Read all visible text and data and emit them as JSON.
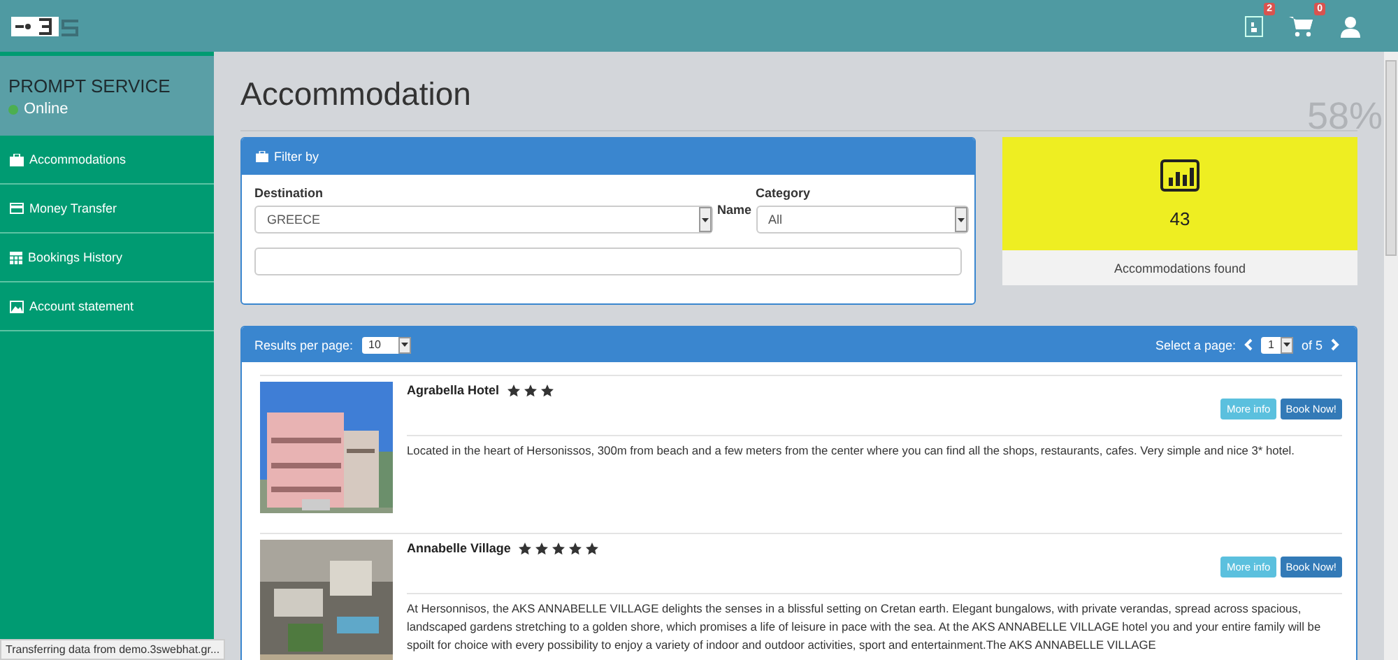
{
  "topbar": {
    "notifications": [
      {
        "kind": "bookings",
        "badge": "2"
      },
      {
        "kind": "cart",
        "badge": "0"
      },
      {
        "kind": "user"
      }
    ]
  },
  "sidebar": {
    "title": "PROMPT SERVICE",
    "status": "Online",
    "items": [
      {
        "label": "Accommodations"
      },
      {
        "label": "Money Transfer"
      },
      {
        "label": "Bookings History"
      },
      {
        "label": "Account statement"
      }
    ]
  },
  "page": {
    "title": "Accommodation",
    "progress": "58%"
  },
  "filter": {
    "title": "Filter by",
    "destination_label": "Destination",
    "destination": "GREECE",
    "name_label": "Name",
    "category_label": "Category",
    "category": "All"
  },
  "stats": {
    "count": "43",
    "label": "Accommodations found"
  },
  "results": {
    "per_page_label": "Results per page:",
    "per_page": "10",
    "page_label": "Select a page:",
    "page": "1",
    "of": "of 5",
    "hotels": [
      {
        "name": "Agrabella Hotel",
        "stars": 3,
        "more": "More info",
        "book": "Book Now!",
        "description": "Located in the heart of Hersonissos, 300m from beach and a few meters from the center where you can find all the shops, restaurants, cafes. Very simple and nice 3* hotel.",
        "kind": "picture"
      },
      {
        "name": "Annabelle Village",
        "stars": 5,
        "more": "More info",
        "book": "Book Now!",
        "description": "At Hersonnisos, the AKS ANNABELLE VILLAGE delights the senses in a blissful setting on Cretan earth. Elegant bungalows, with private verandas, spread across spacious, landscaped gardens stretching to a golden shore, which promises a life of leisure in pace with the sea. At the AKS ANNABELLE VILLAGE hotel you and your entire family will be spoilt for choice with every possibility to enjoy a variety of indoor and outdoor activities, sport and entertainment.The AKS ANNABELLE VILLAGE",
        "kind": "picture"
      }
    ]
  },
  "status_bar": "Transferring data from demo.3swebhat.gr..."
}
